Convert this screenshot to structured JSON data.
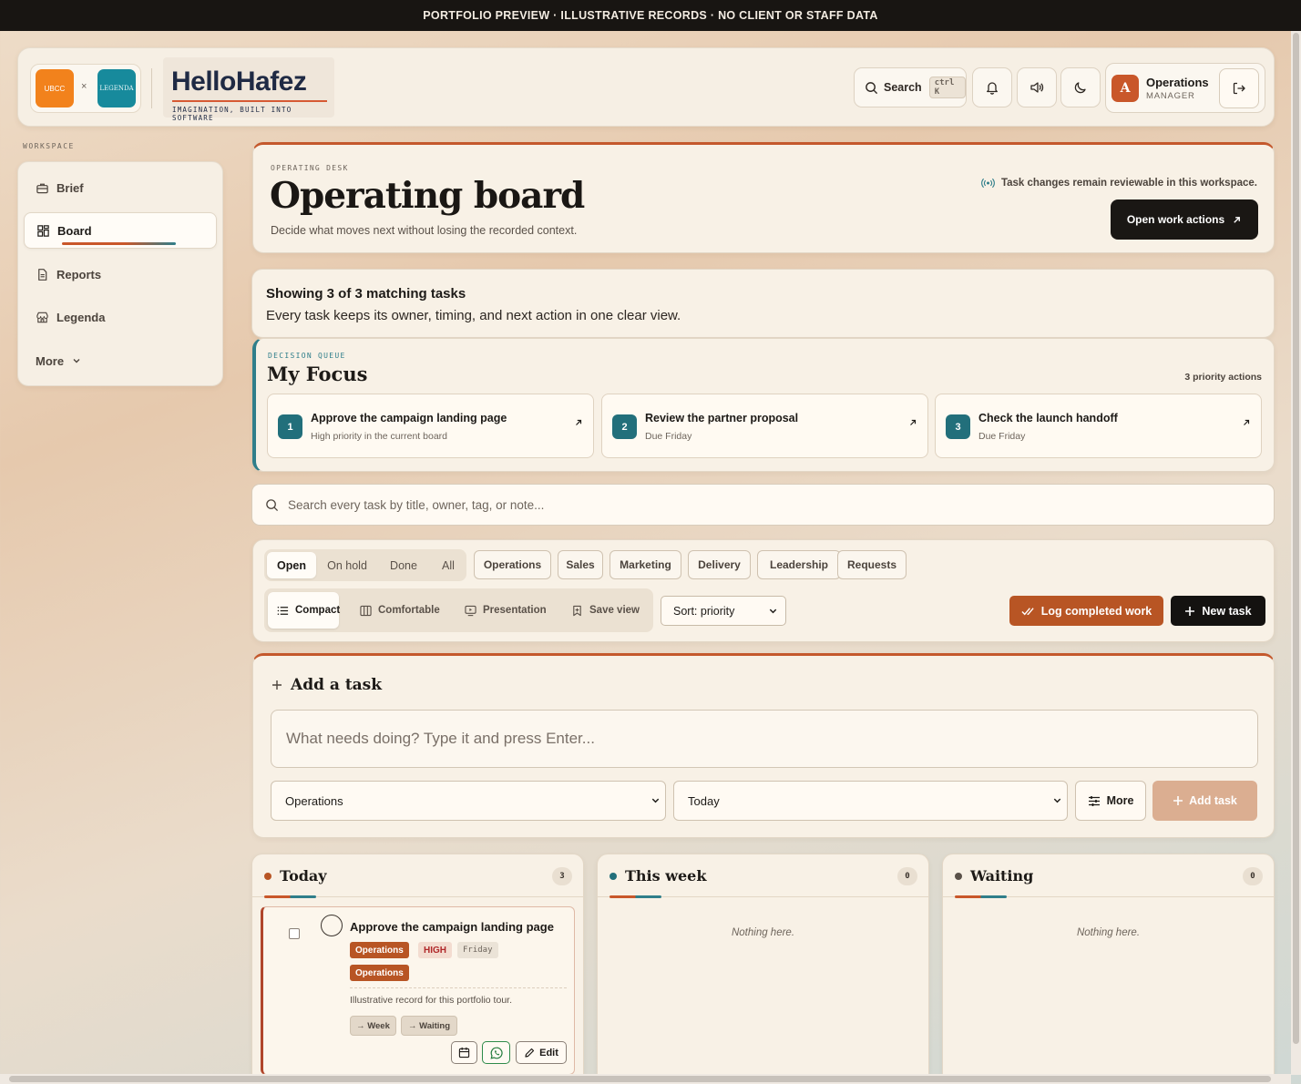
{
  "banner": "PORTFOLIO PREVIEW · ILLUSTRATIVE RECORDS · NO CLIENT OR STAFF DATA",
  "brand": {
    "partner_logo_left": "UBCC",
    "partner_times": "×",
    "partner_logo_right": "LEGENDA",
    "name": "HelloHafez",
    "tagline": "IMAGINATION, BUILT INTO SOFTWARE"
  },
  "header": {
    "search_label": "Search",
    "search_shortcut": "ctrl K",
    "user_initial": "A",
    "user_name": "Operations",
    "user_role": "MANAGER"
  },
  "sidebar": {
    "section_label": "WORKSPACE",
    "items": [
      {
        "label": "Brief",
        "icon": "briefcase-icon"
      },
      {
        "label": "Board",
        "icon": "grid-icon",
        "active": true
      },
      {
        "label": "Reports",
        "icon": "document-icon"
      },
      {
        "label": "Legenda",
        "icon": "store-icon"
      },
      {
        "label": "More",
        "icon": "chevron-down-icon"
      }
    ]
  },
  "hero": {
    "eyebrow": "OPERATING DESK",
    "title": "Operating board",
    "subtitle": "Decide what moves next without losing the recorded context.",
    "note": "Task changes remain reviewable in this workspace.",
    "action_label": "Open work actions"
  },
  "summary": {
    "title": "Showing 3 of 3 matching tasks",
    "subtitle": "Every task keeps its owner, timing, and next action in one clear view."
  },
  "focus": {
    "eyebrow": "DECISION QUEUE",
    "title": "My Focus",
    "count_label": "3 priority actions",
    "items": [
      {
        "num": "1",
        "title": "Approve the campaign landing page",
        "sub": "High priority in the current board"
      },
      {
        "num": "2",
        "title": "Review the partner proposal",
        "sub": "Due Friday"
      },
      {
        "num": "3",
        "title": "Check the launch handoff",
        "sub": "Due Friday"
      }
    ]
  },
  "search": {
    "placeholder": "Search every task by title, owner, tag, or note..."
  },
  "filters": {
    "status_tabs": [
      "Open",
      "On hold",
      "Done",
      "All"
    ],
    "categories": [
      "Operations",
      "Sales",
      "Marketing",
      "Delivery",
      "Leadership",
      "Requests"
    ],
    "views": [
      "Compact",
      "Comfortable",
      "Presentation",
      "Save view"
    ],
    "sort_label": "Sort: priority",
    "log_label": "Log completed work",
    "new_label": "New task"
  },
  "add_task": {
    "title": "Add a task",
    "placeholder": "What needs doing? Type it and press Enter...",
    "area_value": "Operations",
    "when_value": "Today",
    "more_label": "More",
    "submit_label": "Add task"
  },
  "columns": [
    {
      "title": "Today",
      "count": "3",
      "dot_color": "#b85524"
    },
    {
      "title": "This week",
      "count": "0",
      "dot_color": "#226f7b",
      "empty": "Nothing here."
    },
    {
      "title": "Waiting",
      "count": "0",
      "dot_color": "#5a5149",
      "empty": "Nothing here."
    }
  ],
  "task": {
    "title": "Approve the campaign landing page",
    "tag_area": "Operations",
    "tag_priority": "HIGH",
    "tag_day": "Friday",
    "tag_area_2": "Operations",
    "note": "Illustrative record for this portfolio tour.",
    "move_week": "→ Week",
    "move_waiting": "→ Waiting",
    "edit_label": "Edit"
  },
  "colors": {
    "accent": "#c4582c",
    "teal": "#2f7e8a",
    "dark": "#141210"
  }
}
